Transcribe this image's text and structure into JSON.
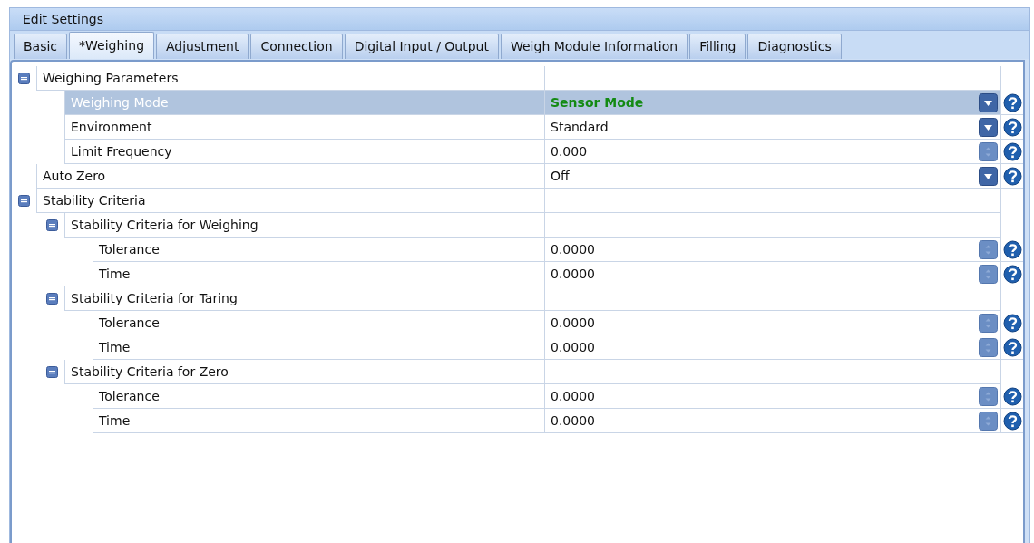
{
  "window": {
    "title": "Edit Settings"
  },
  "tabs": [
    {
      "label": "Basic",
      "selected": false
    },
    {
      "label": "*Weighing",
      "selected": true
    },
    {
      "label": "Adjustment",
      "selected": false
    },
    {
      "label": "Connection",
      "selected": false
    },
    {
      "label": "Digital Input / Output",
      "selected": false
    },
    {
      "label": "Weigh Module Information",
      "selected": false
    },
    {
      "label": "Filling",
      "selected": false
    },
    {
      "label": "Diagnostics",
      "selected": false
    }
  ],
  "tree": [
    {
      "kind": "category",
      "label": "Weighing Parameters",
      "expanded": true,
      "children": [
        {
          "kind": "property",
          "label": "Weighing Mode",
          "value": "Sensor Mode",
          "editor": {
            "kind": "dropdown"
          },
          "selected": true,
          "modified": true
        },
        {
          "kind": "property",
          "label": "Environment",
          "value": "Standard",
          "editor": {
            "kind": "dropdown"
          },
          "selected": false,
          "modified": false
        },
        {
          "kind": "property",
          "label": "Limit Frequency",
          "value": "0.000",
          "editor": {
            "kind": "spinner"
          },
          "selected": false,
          "modified": false
        }
      ]
    },
    {
      "kind": "property",
      "label": "Auto Zero",
      "value": "Off",
      "editor": {
        "kind": "dropdown"
      },
      "selected": false,
      "modified": false
    },
    {
      "kind": "category",
      "label": "Stability Criteria",
      "expanded": true,
      "children": [
        {
          "kind": "category",
          "label": "Stability Criteria for Weighing",
          "expanded": true,
          "children": [
            {
              "kind": "property",
              "label": "Tolerance",
              "value": "0.0000",
              "editor": {
                "kind": "spinner"
              },
              "selected": false,
              "modified": false
            },
            {
              "kind": "property",
              "label": "Time",
              "value": "0.0000",
              "editor": {
                "kind": "spinner"
              },
              "selected": false,
              "modified": false
            }
          ]
        },
        {
          "kind": "category",
          "label": "Stability Criteria for Taring",
          "expanded": true,
          "children": [
            {
              "kind": "property",
              "label": "Tolerance",
              "value": "0.0000",
              "editor": {
                "kind": "spinner"
              },
              "selected": false,
              "modified": false
            },
            {
              "kind": "property",
              "label": "Time",
              "value": "0.0000",
              "editor": {
                "kind": "spinner"
              },
              "selected": false,
              "modified": false
            }
          ]
        },
        {
          "kind": "category",
          "label": "Stability Criteria for Zero",
          "expanded": true,
          "children": [
            {
              "kind": "property",
              "label": "Tolerance",
              "value": "0.0000",
              "editor": {
                "kind": "spinner"
              },
              "selected": false,
              "modified": false
            },
            {
              "kind": "property",
              "label": "Time",
              "value": "0.0000",
              "editor": {
                "kind": "spinner"
              },
              "selected": false,
              "modified": false
            }
          ]
        }
      ]
    }
  ]
}
